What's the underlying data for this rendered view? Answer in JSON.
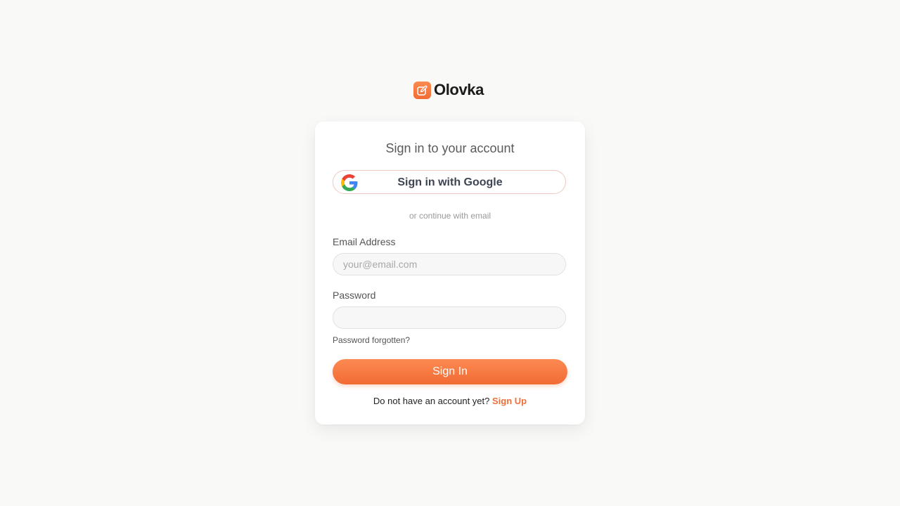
{
  "brand": {
    "name": "Olovka",
    "icon": "edit-square-icon",
    "color": "#f26c34"
  },
  "card": {
    "title": "Sign in to your account",
    "google_button": {
      "label": "Sign in with Google",
      "icon": "google-icon"
    },
    "divider": "or continue with email",
    "email": {
      "label": "Email Address",
      "placeholder": "your@email.com",
      "value": ""
    },
    "password": {
      "label": "Password",
      "value": ""
    },
    "forgot_label": "Password forgotten?",
    "submit_label": "Sign In",
    "signup_prompt": "Do not have an account yet?",
    "signup_label": "Sign Up"
  },
  "colors": {
    "accent": "#f26c34",
    "accent_light": "#fc8a52",
    "background": "#f9f9f8",
    "card": "#ffffff"
  }
}
